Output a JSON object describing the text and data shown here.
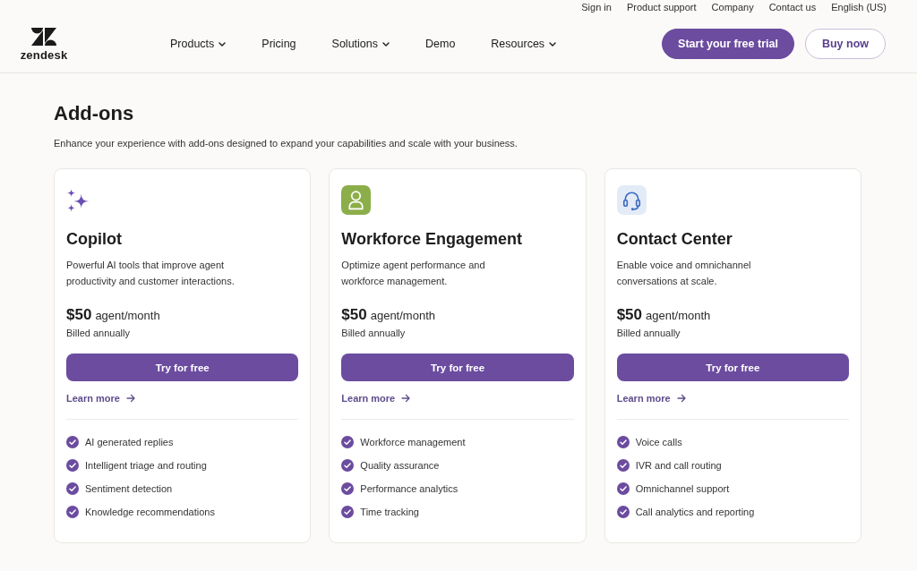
{
  "utility_links": [
    "Sign in",
    "Product support",
    "Company",
    "Contact us",
    "English (US)"
  ],
  "header": {
    "logo_text": "zendesk",
    "nav": [
      {
        "label": "Products",
        "has_menu": true
      },
      {
        "label": "Pricing",
        "has_menu": false
      },
      {
        "label": "Solutions",
        "has_menu": true
      },
      {
        "label": "Demo",
        "has_menu": false
      },
      {
        "label": "Resources",
        "has_menu": true
      }
    ],
    "buttons": [
      {
        "label": "Start your free trial",
        "kind": "primary"
      },
      {
        "label": "Buy now",
        "kind": "outline"
      }
    ]
  },
  "section": {
    "title": "Add-ons",
    "subtitle": "Enhance your experience with add-ons designed to expand your capabilities and scale with your business."
  },
  "cards": [
    {
      "title": "Copilot",
      "description": "Powerful AI tools that improve agent productivity and customer interactions.",
      "price": "$50",
      "unit": "agent/month",
      "billing": "Billed annually",
      "button": "Try for free",
      "link": "Learn more",
      "features": [
        "AI generated replies",
        "Intelligent triage and routing",
        "Sentiment detection",
        "Knowledge recommendations"
      ]
    },
    {
      "title": "Workforce Engagement",
      "description": "Optimize agent performance and workforce management.",
      "price": "$50",
      "unit": "agent/month",
      "billing": "Billed annually",
      "button": "Try for free",
      "link": "Learn more",
      "features": [
        "Workforce management",
        "Quality assurance",
        "Performance analytics",
        "Time tracking"
      ]
    },
    {
      "title": "Contact Center",
      "description": "Enable voice and omnichannel conversations at scale.",
      "price": "$50",
      "unit": "agent/month",
      "billing": "Billed annually",
      "button": "Try for free",
      "link": "Learn more",
      "features": [
        "Voice calls",
        "IVR and call routing",
        "Omnichannel support",
        "Call analytics and reporting"
      ]
    }
  ]
}
